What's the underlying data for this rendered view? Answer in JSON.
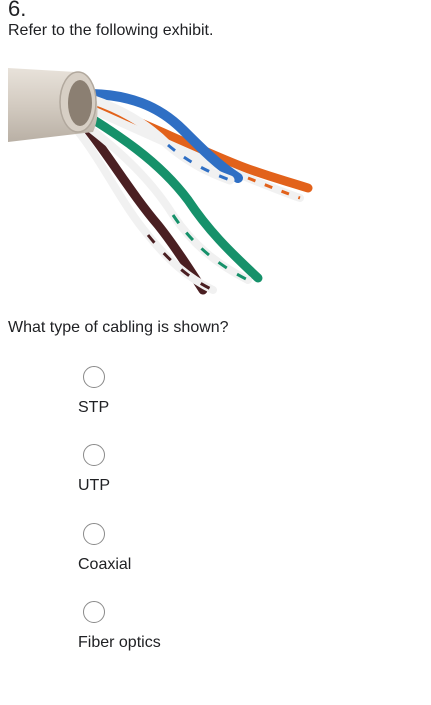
{
  "question": {
    "number": "6.",
    "intro": "Refer to the following exhibit.",
    "text": "What type of cabling is shown?",
    "options": [
      {
        "label": "STP"
      },
      {
        "label": "UTP"
      },
      {
        "label": "Coaxial"
      },
      {
        "label": "Fiber optics"
      }
    ]
  },
  "exhibit": {
    "subject": "twisted-pair network cable",
    "colors": {
      "jacket": "#d9d2c9",
      "blue": "#2f6fc4",
      "orange": "#e2621b",
      "green": "#16916a",
      "brown": "#4a1f22",
      "white": "#f4f4f4"
    }
  }
}
